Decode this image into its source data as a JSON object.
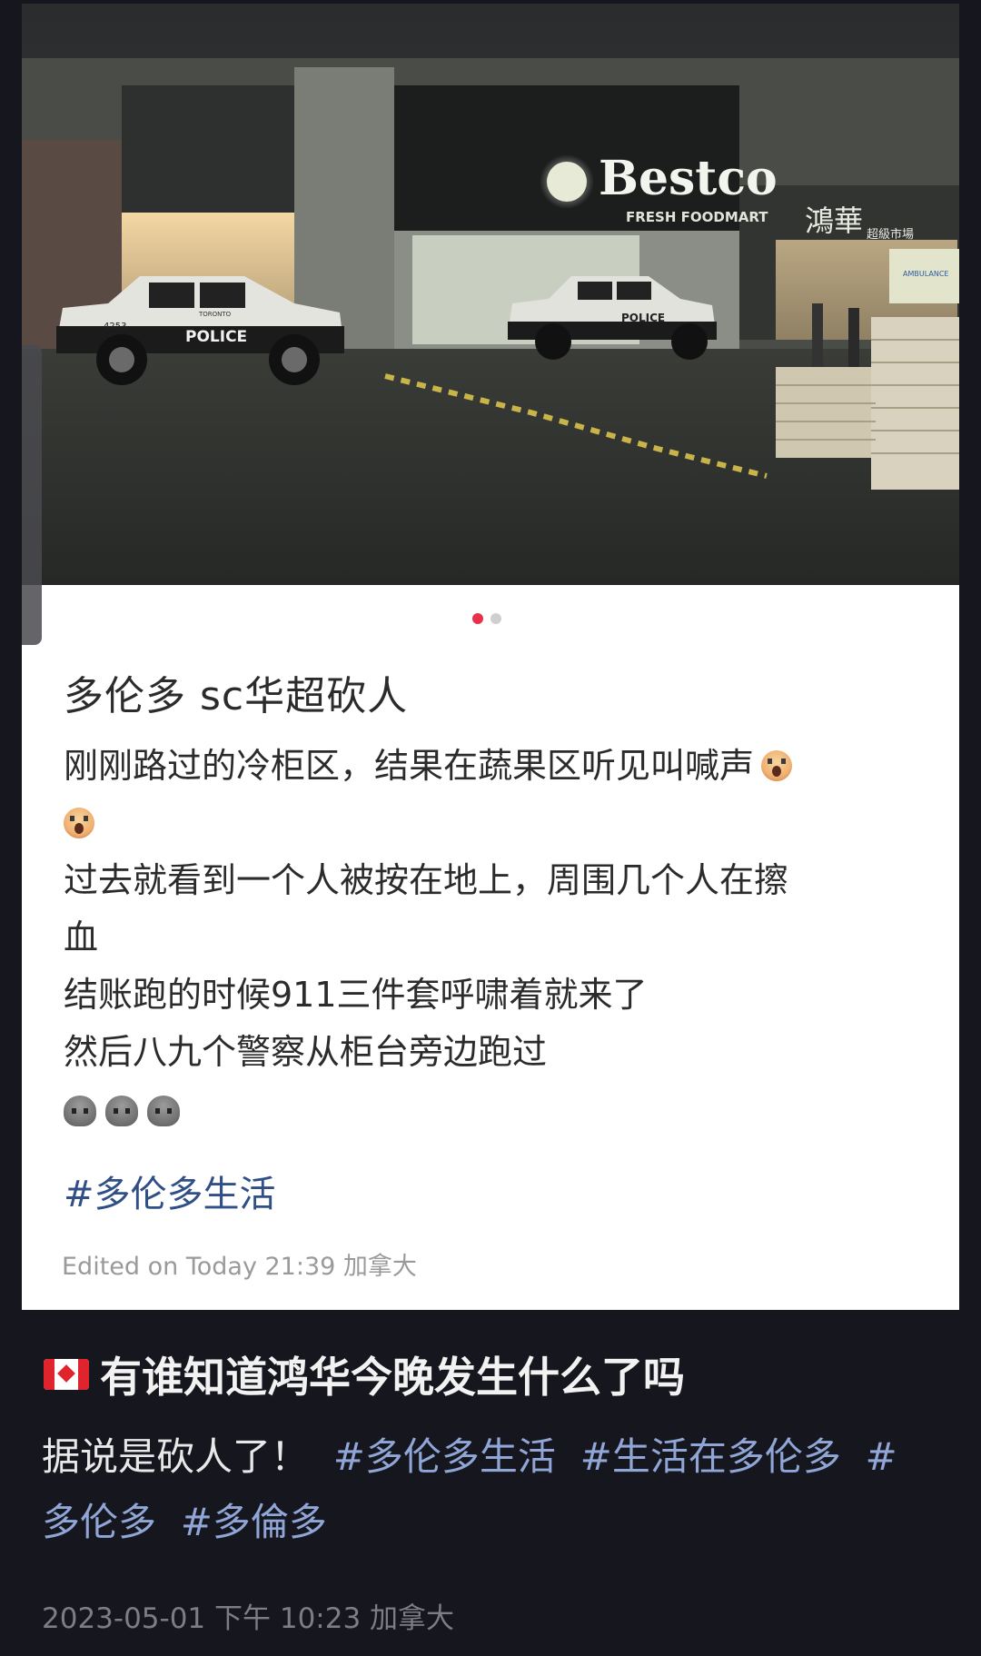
{
  "embedded_post": {
    "photo_signs": {
      "store_name": "Bestco",
      "store_sub": "FRESH FOODMART",
      "store_chinese": "鴻華",
      "store_chinese_sub": "超級市場",
      "car1_label": "POLICE",
      "car1_top": "TORONTO",
      "car1_number": "4253",
      "car2_label": "POLICE",
      "ambulance_label": "AMBULANCE"
    },
    "carousel": {
      "count": 2,
      "active_index": 0
    },
    "title": "多伦多 sc华超砍人",
    "body_lines": [
      "刚刚路过的冷柜区，结果在蔬果区听见叫喊声",
      "",
      "过去就看到一个人被按在地上，周围几个人在擦",
      "血",
      "结账跑的时候911三件套呼啸着就来了",
      "然后八九个警察从柜台旁边跑过"
    ],
    "hashtag": "#多伦多生活",
    "edited": "Edited on  Today 21:39 加拿大"
  },
  "post": {
    "flag_icon": "canada-flag-icon",
    "title": "有谁知道鸿华今晚发生什么了吗",
    "body_text": "据说是砍人了！",
    "tags": [
      "#多伦多生活",
      "#生活在多伦多",
      "#",
      "多伦多",
      "#多倫多"
    ],
    "date": "2023-05-01 下午 10:23 加拿大"
  },
  "colors": {
    "background": "#16161e",
    "hashtag_card": "#2f4f86",
    "hashtag_outer": "#8fa6d6",
    "carousel_active": "#e8304a"
  }
}
